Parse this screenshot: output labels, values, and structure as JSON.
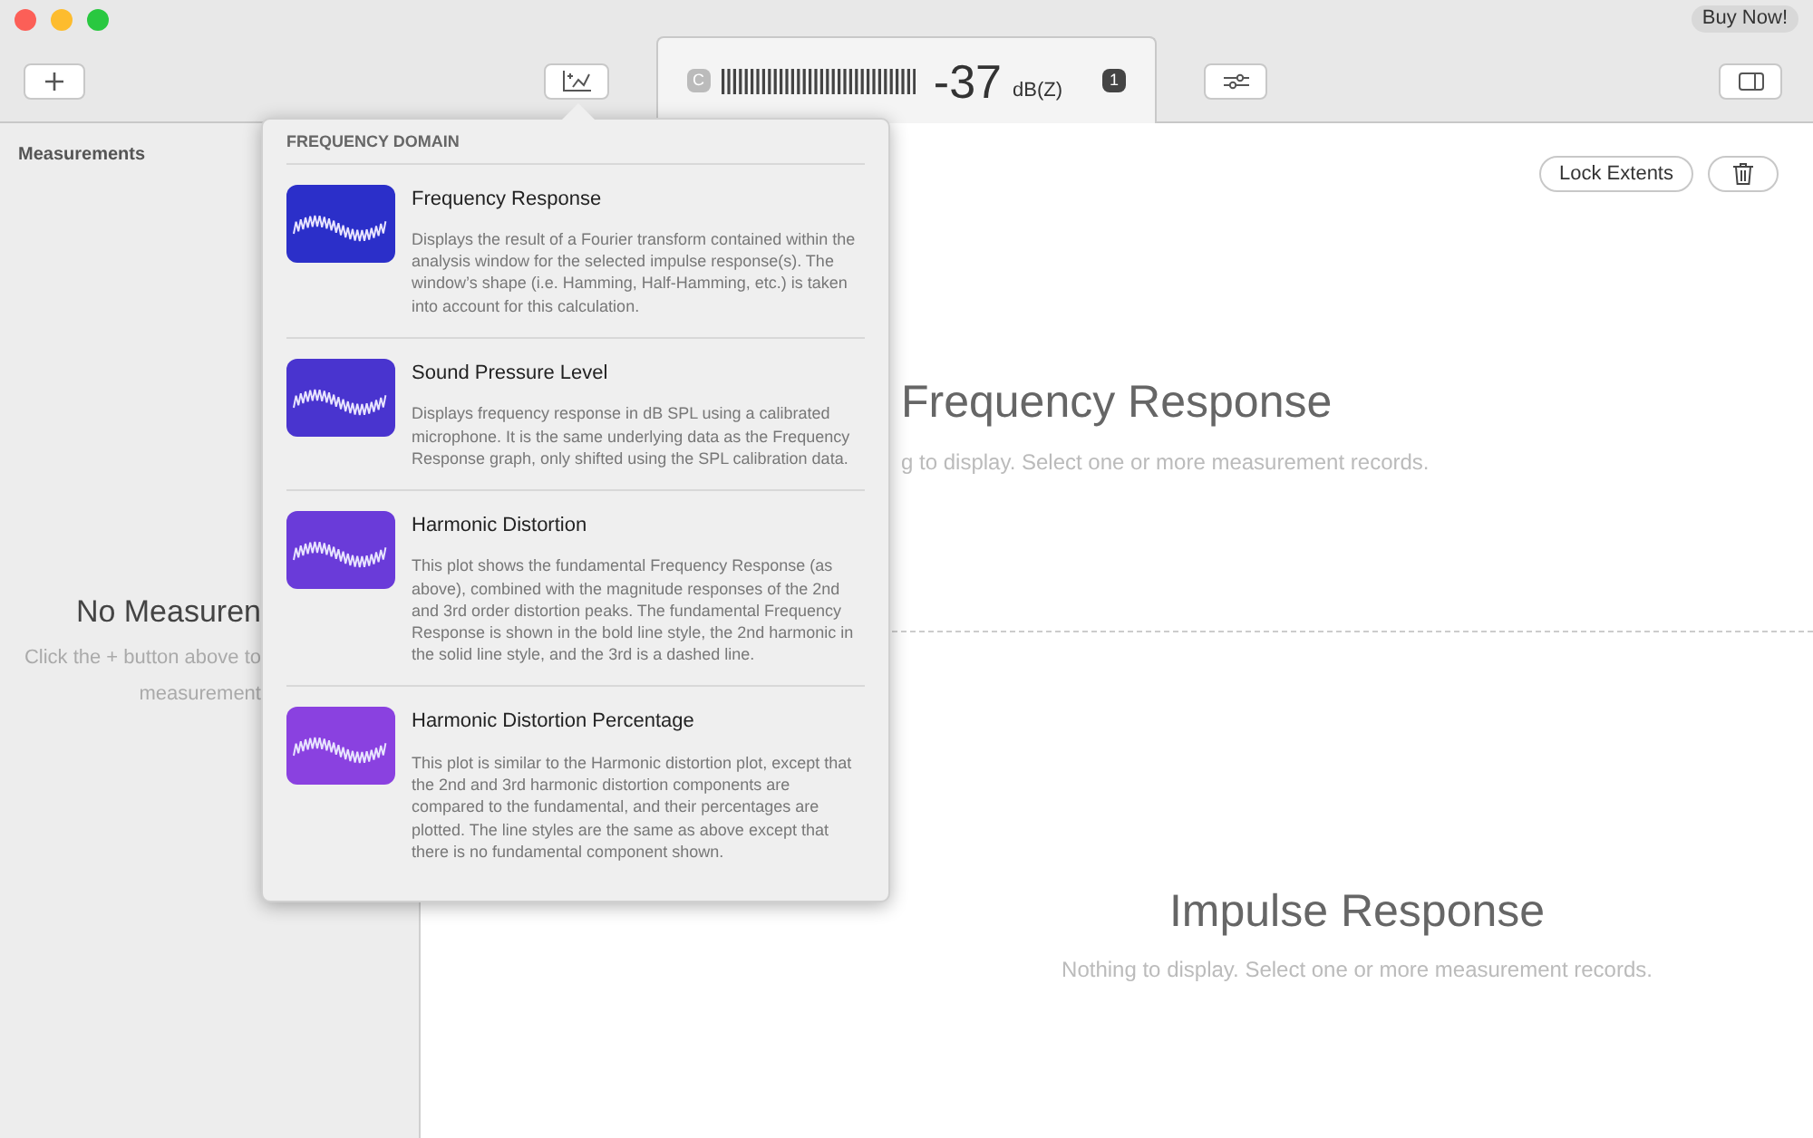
{
  "title_bar": {
    "buy_button": "Buy Now!"
  },
  "meter": {
    "weighting": "C",
    "reading": "-37",
    "unit": "dB(Z)",
    "channel": "1"
  },
  "sidebar": {
    "title": "Measurements",
    "empty_title": "No Measuren",
    "empty_hint_lines": [
      "Click the + button above to",
      "measurement"
    ]
  },
  "popover": {
    "section": "FREQUENCY DOMAIN",
    "items": [
      {
        "title": "Frequency Response",
        "description": "Displays the result of a Fourier transform contained within the analysis window for the selected impulse response(s). The window’s shape (i.e. Hamming, Half-Hamming, etc.) is taken into account for this calculation.",
        "color": "#2b2fc9"
      },
      {
        "title": "Sound Pressure Level",
        "description": "Displays frequency response in dB SPL using a calibrated microphone. It is the same underlying data as the Frequency Response graph, only shifted using the SPL calibration data.",
        "color": "#4934cf"
      },
      {
        "title": "Harmonic Distortion",
        "description": "This plot shows the fundamental Frequency Response (as above), combined with the magnitude responses of the 2nd and 3rd order distortion peaks. The fundamental Frequency Response is shown in the bold line style, the 2nd harmonic in the solid line style, and the 3rd is a dashed line.",
        "color": "#6a3bd9"
      },
      {
        "title": "Harmonic Distortion Percentage",
        "description": "This plot is similar to the Harmonic distortion plot, except that the 2nd and 3rd harmonic distortion components are compared to the fundamental, and their percentages are plotted. The line styles are the same as above except that there is no fundamental component shown.",
        "color": "#8a41e0"
      }
    ]
  },
  "toolbar": {
    "lock_button": "Lock Extents"
  },
  "panes": [
    {
      "title": "Frequency Response",
      "message": "g to display. Select one or more measurement records."
    },
    {
      "title": "Impulse Response",
      "message": "Nothing to display. Select one or more measurement records."
    }
  ]
}
